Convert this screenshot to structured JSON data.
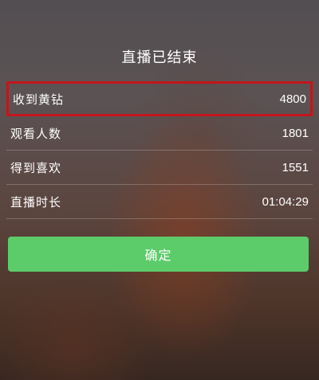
{
  "header": {
    "title": "直播已结束"
  },
  "stats": [
    {
      "label": "收到黄钻",
      "value": "4800"
    },
    {
      "label": "观看人数",
      "value": "1801"
    },
    {
      "label": "得到喜欢",
      "value": "1551"
    },
    {
      "label": "直播时长",
      "value": "01:04:29"
    }
  ],
  "actions": {
    "confirm_label": "确定"
  },
  "colors": {
    "confirm_button": "#5ccc6b",
    "highlight_border": "#c4151c"
  }
}
